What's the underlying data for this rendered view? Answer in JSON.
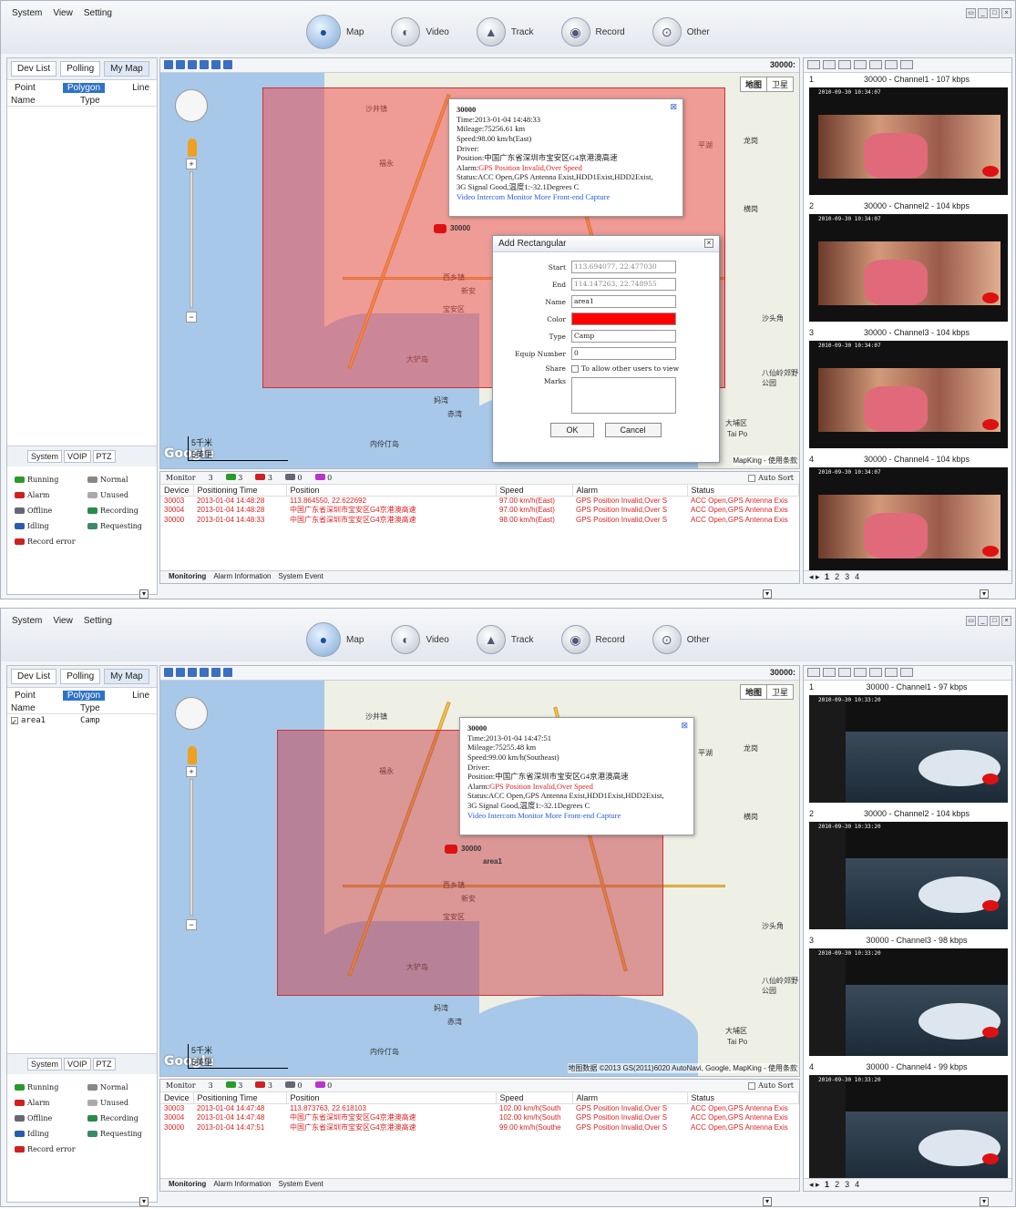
{
  "menus": [
    "System",
    "View",
    "Setting"
  ],
  "module_tabs": [
    "Map",
    "Video",
    "Track",
    "Record",
    "Other"
  ],
  "left": {
    "tabs": [
      "Dev List",
      "Polling",
      "My Map"
    ],
    "subtabs": [
      "Point",
      "Polygon",
      "Line"
    ],
    "cols": [
      "Name",
      "Type"
    ],
    "bottom_tabs": [
      "System",
      "VOIP",
      "PTZ"
    ],
    "legend": [
      "Running",
      "Normal",
      "Alarm",
      "Unused",
      "Offline",
      "Recording",
      "Idling",
      "Requesting",
      "Record error"
    ]
  },
  "panel_top": {
    "device_count": "30000:",
    "popup": {
      "id": "30000",
      "time": "Time:2013-01-04 14:48:33",
      "mileage": "Mileage:75256.61 km",
      "speed": "Speed:98.00 km/h(East)",
      "driver": "Driver:",
      "position": "Position:中国广东省深圳市宝安区G4京港澳高速",
      "alarm_label": "Alarm:",
      "alarm": "GPS Position Invalid,Over Speed",
      "status": "Status:ACC Open,GPS Antenna Exist,HDD1Exist,HDD2Exist,",
      "status2": "3G Signal Good,温度1:-32.1Degrees C",
      "links": "Video  Intercom  Monitor  More  Front-end Capture"
    },
    "dialog": {
      "title": "Add Rectangular",
      "start_label": "Start",
      "start": "113.694077, 22.477030",
      "end_label": "End",
      "end": "114.147263, 22.748955",
      "name_label": "Name",
      "name": "area1",
      "color_label": "Color",
      "type_label": "Type",
      "type": "Camp",
      "equip_label": "Equip Number",
      "equip": "0",
      "share_label": "Share",
      "share": "To allow other users to view",
      "marks_label": "Marks",
      "ok": "OK",
      "cancel": "Cancel"
    },
    "copyright": "MapKing - 使用条款",
    "monitor": {
      "label": "Monitor",
      "total": "3",
      "running": "3",
      "alarm": "3",
      "offline": "0",
      "idling": "0",
      "auto_sort": "Auto Sort"
    },
    "rows": [
      [
        "30003",
        "2013-01-04 14:48:28",
        "113.864550, 22.622692",
        "97.00 km/h(East)",
        "GPS Position Invalid,Over S",
        "ACC Open,GPS Antenna Exis"
      ],
      [
        "30004",
        "2013-01-04 14:48:28",
        "中国广东省深圳市宝安区G4京港澳高速",
        "97.00 km/h(East)",
        "GPS Position Invalid,Over S",
        "ACC Open,GPS Antenna Exis"
      ],
      [
        "30000",
        "2013-01-04 14:48:33",
        "中国广东省深圳市宝安区G4京港澳高速",
        "98.00 km/h(East)",
        "GPS Position Invalid,Over S",
        "ACC Open,GPS Antenna Exis"
      ]
    ],
    "channels": [
      "30000 - Channel1 - 107 kbps",
      "30000 - Channel2 - 104 kbps",
      "30000 - Channel3 - 104 kbps",
      "30000 - Channel4 - 104 kbps"
    ],
    "video_ts": "2010-09-30 10:34:07"
  },
  "panel_bottom": {
    "device_count": "30000:",
    "list_item": {
      "name": "area1",
      "type": "Camp"
    },
    "region_label": "area1",
    "popup": {
      "id": "30000",
      "time": "Time:2013-01-04 14:47:51",
      "mileage": "Mileage:75255.48 km",
      "speed": "Speed:99.00 km/h(Southeast)",
      "driver": "Driver:",
      "position": "Position:中国广东省深圳市宝安区G4京港澳高速",
      "alarm_label": "Alarm:",
      "alarm": "GPS Position Invalid,Over Speed",
      "status": "Status:ACC Open,GPS Antenna Exist,HDD1Exist,HDD2Exist,",
      "status2": "3G Signal Good,温度1:-32.1Degrees C",
      "links": "Video  Intercom  Monitor  More  Front-end Capture"
    },
    "copyright": "地图数据 ©2013 GS(2011)6020 AutoNavi, Google, MapKing - 使用条款",
    "monitor": {
      "label": "Monitor",
      "total": "3",
      "running": "3",
      "alarm": "3",
      "offline": "0",
      "idling": "0",
      "auto_sort": "Auto Sort"
    },
    "rows": [
      [
        "30003",
        "2013-01-04 14:47:48",
        "113.873763, 22.618103",
        "102.00 km/h(South",
        "GPS Position Invalid,Over S",
        "ACC Open,GPS Antenna Exis"
      ],
      [
        "30004",
        "2013-01-04 14:47:48",
        "中国广东省深圳市宝安区G4京港澳高速",
        "102.00 km/h(South",
        "GPS Position Invalid,Over S",
        "ACC Open,GPS Antenna Exis"
      ],
      [
        "30000",
        "2013-01-04 14:47:51",
        "中国广东省深圳市宝安区G4京港澳高速",
        "99.00 km/h(Southe",
        "GPS Position Invalid,Over S",
        "ACC Open,GPS Antenna Exis"
      ]
    ],
    "channels": [
      "30000 - Channel1 - 97 kbps",
      "30000 - Channel2 - 104 kbps",
      "30000 - Channel3 - 98 kbps",
      "30000 - Channel4 - 99 kbps"
    ],
    "video_ts": "2010-09-30 10:33:20"
  },
  "table_cols": [
    "Device",
    "Positioning Time",
    "Position",
    "Speed",
    "Alarm",
    "Status"
  ],
  "map_types": [
    "地图",
    "卫星"
  ],
  "scale": [
    "5千米",
    "5英里"
  ],
  "bottom_tabs": [
    "Monitoring",
    "Alarm Information",
    "System Event"
  ],
  "pages": [
    "1",
    "2",
    "3",
    "4"
  ],
  "map_labels": [
    "沙井镇",
    "福永",
    "西乡镇",
    "新安",
    "宝安区",
    "大铲岛",
    "妈湾",
    "赤湾",
    "平湖",
    "龙岗",
    "横岗",
    "大埔区",
    "Tai Po",
    "八仙岭郊野公园",
    "沙头角",
    "内伶仃岛"
  ],
  "colors": {
    "accent": "#2f73c8",
    "region": "#f04646",
    "alarm_text": "#d22222"
  }
}
